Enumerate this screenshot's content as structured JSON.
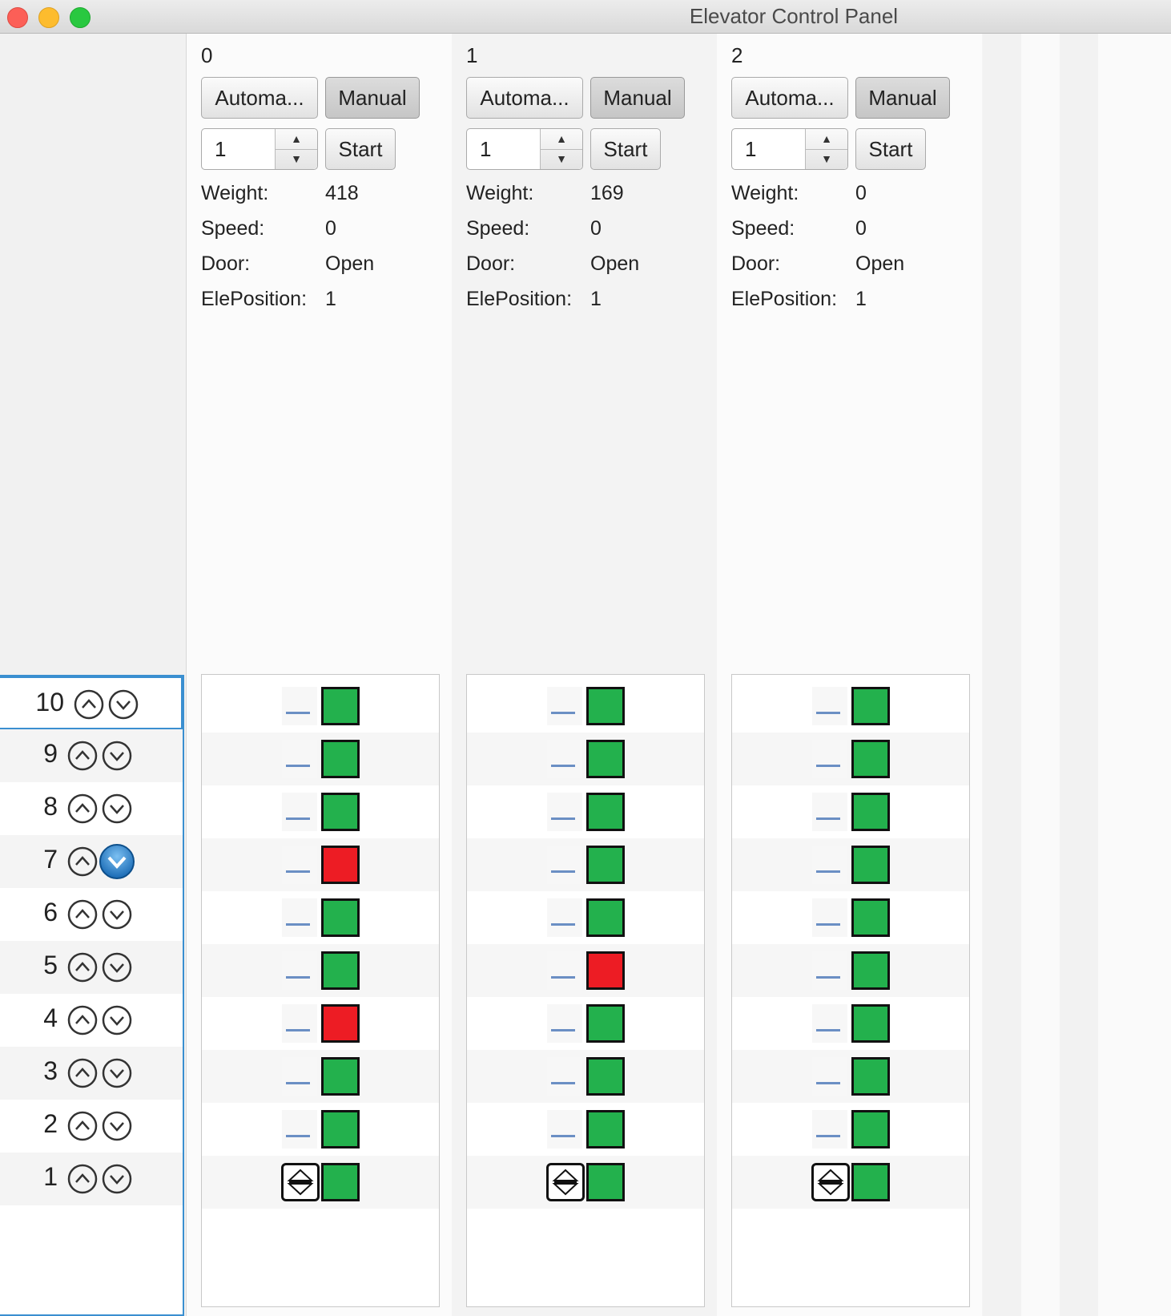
{
  "window": {
    "title": "Elevator Control Panel"
  },
  "elevators": [
    {
      "index": "0",
      "auto_label": "Automa...",
      "manual_label": "Manual",
      "spinner_value": "1",
      "start_label": "Start",
      "weight_label": "Weight:",
      "weight": "418",
      "speed_label": "Speed:",
      "speed": "0",
      "door_label": "Door:",
      "door": "Open",
      "pos_label": "ElePosition:",
      "position": "1",
      "lamps": [
        "green",
        "green",
        "green",
        "red",
        "green",
        "green",
        "red",
        "green",
        "green",
        "green"
      ]
    },
    {
      "index": "1",
      "auto_label": "Automa...",
      "manual_label": "Manual",
      "spinner_value": "1",
      "start_label": "Start",
      "weight_label": "Weight:",
      "weight": "169",
      "speed_label": "Speed:",
      "speed": "0",
      "door_label": "Door:",
      "door": "Open",
      "pos_label": "ElePosition:",
      "position": "1",
      "lamps": [
        "green",
        "green",
        "green",
        "green",
        "green",
        "red",
        "green",
        "green",
        "green",
        "green"
      ]
    },
    {
      "index": "2",
      "auto_label": "Automa...",
      "manual_label": "Manual",
      "spinner_value": "1",
      "start_label": "Start",
      "weight_label": "Weight:",
      "weight": "0",
      "speed_label": "Speed:",
      "speed": "0",
      "door_label": "Door:",
      "door": "Open",
      "pos_label": "ElePosition:",
      "position": "1",
      "lamps": [
        "green",
        "green",
        "green",
        "green",
        "green",
        "green",
        "green",
        "green",
        "green",
        "green"
      ]
    }
  ],
  "floors": [
    {
      "label": "10",
      "down_active": false
    },
    {
      "label": "9",
      "down_active": false
    },
    {
      "label": "8",
      "down_active": false
    },
    {
      "label": "7",
      "down_active": true
    },
    {
      "label": "6",
      "down_active": false
    },
    {
      "label": "5",
      "down_active": false
    },
    {
      "label": "4",
      "down_active": false
    },
    {
      "label": "3",
      "down_active": false
    },
    {
      "label": "2",
      "down_active": false
    },
    {
      "label": "1",
      "down_active": false
    }
  ],
  "colors": {
    "lamp_green": "#23b14d",
    "lamp_red": "#ed1c24",
    "accent": "#3a8fd0"
  },
  "icons": {
    "up": "chevron-up-circle-icon",
    "down": "chevron-down-circle-icon",
    "cabin": "up-down-arrows-icon"
  }
}
